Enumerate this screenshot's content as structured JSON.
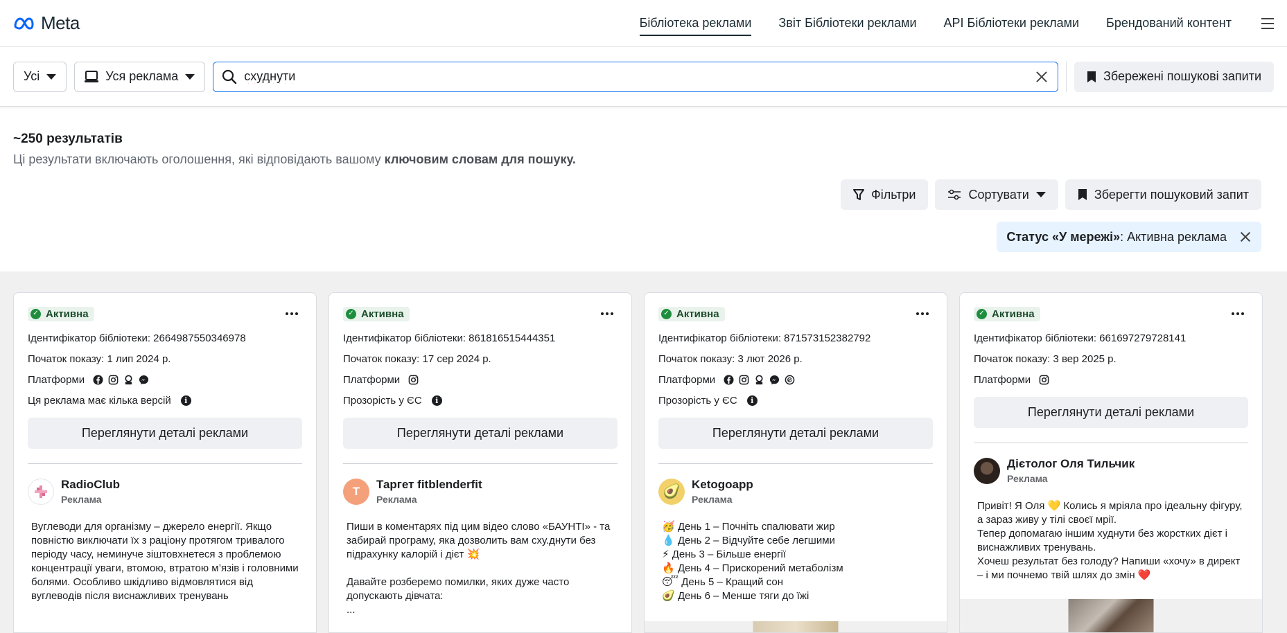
{
  "header": {
    "logo_text": "Meta",
    "nav": [
      {
        "label": "Бібліотека реклами",
        "active": true
      },
      {
        "label": "Звіт Бібліотеки реклами",
        "active": false
      },
      {
        "label": "API Бібліотеки реклами",
        "active": false
      },
      {
        "label": "Брендований контент",
        "active": false
      }
    ]
  },
  "search": {
    "country_label": "Усі",
    "category_label": "Уся реклама",
    "query": "схуднути",
    "saved_searches_label": "Збережені пошукові запити"
  },
  "results": {
    "count": "~250 результатів",
    "subtitle_prefix": "Ці результати включають оголошення, які відповідають вашому ",
    "subtitle_bold": "ключовим словам для пошуку.",
    "filters_label": "Фільтри",
    "sort_label": "Сортувати",
    "save_search_label": "Зберегти пошуковий запит",
    "active_filter_bold": "Статус «У мережі»",
    "active_filter_rest": ": Активна реклама"
  },
  "cards": [
    {
      "status": "Активна",
      "library_id": "Ідентифікатор бібліотеки: 2664987550346978",
      "start": "Початок показу: 1 лип 2024 р.",
      "platforms_label": "Платформи",
      "platforms": [
        "facebook-icon",
        "instagram-icon",
        "audience-network-icon",
        "messenger-icon"
      ],
      "extra": "Ця реклама має кілька версій",
      "details_button": "Переглянути деталі реклами",
      "advertiser": "RadioClub",
      "sponsored": "Реклама",
      "avatar_color": "#ffffff",
      "avatar_letter": "",
      "body": "Вуглеводи для організму – джерело енергії. Якщо повністю виключати їх з раціону протягом тривалого періоду часу, неминуче зіштовхнетеся з проблемою концентрації уваги, втомою, втратою м’язів і головними болями.  Особливо шкідливо відмовлятися від вуглеводів після виснажливих тренувань"
    },
    {
      "status": "Активна",
      "library_id": "Ідентифікатор бібліотеки: 861816515444351",
      "start": "Початок показу: 17 сер 2024 р.",
      "platforms_label": "Платформи",
      "platforms": [
        "instagram-icon"
      ],
      "extra": "Прозорість у ЄС",
      "details_button": "Переглянути деталі реклами",
      "advertiser": "Таргет fitblenderfit",
      "sponsored": "Реклама",
      "avatar_color": "#f4a07a",
      "avatar_letter": "T",
      "body": "Пиши в коментарях під цим відео слово «БАУНТІ» - та забирай програму, яка дозволить вам сху.днути без підрахунку калорій і дієт 💥\n\nДавайте розберемо помилки, яких дуже часто допускають дівчата:\n..."
    },
    {
      "status": "Активна",
      "library_id": "Ідентифікатор бібліотеки: 871573152382792",
      "start": "Початок показу: 3 лют 2026 р.",
      "platforms_label": "Платформи",
      "platforms": [
        "facebook-icon",
        "instagram-icon",
        "audience-network-icon",
        "messenger-icon",
        "threads-icon"
      ],
      "extra": "Прозорість у ЄС",
      "details_button": "Переглянути деталі реклами",
      "advertiser": "Ketogoapp",
      "sponsored": "Реклама",
      "avatar_color": "#f2d16b",
      "avatar_letter": "🥑",
      "body": "🥳 День 1 – Почніть спалювати жир\n💧 День 2 – Відчуйте себе легшими\n⚡ День 3 – Більше енергії\n🔥 День 4 – Прискорений метаболізм\n😴 День 5 – Кращий сон\n🥑 День 6 – Менше тяги до їжі"
    },
    {
      "status": "Активна",
      "library_id": "Ідентифікатор бібліотеки: 661697279728141",
      "start": "Початок показу: 3 вер 2025 р.",
      "platforms_label": "Платформи",
      "platforms": [
        "instagram-icon"
      ],
      "extra": "",
      "details_button": "Переглянути деталі реклами",
      "advertiser": "Дієтолог Оля Тильчик",
      "sponsored": "Реклама",
      "avatar_color": "#3a2e28",
      "avatar_letter": "",
      "body": "Привіт! Я Оля 💛 Колись я мріяла про ідеальну фігуру, а зараз живу у тілі своєї мрії.\nТепер допомагаю іншим худнути без жорстких дієт і виснажливих тренувань.\nХочеш результат без голоду? Напиши «хочу» в директ – і ми почнемо твій шлях до змін ❤️"
    }
  ]
}
